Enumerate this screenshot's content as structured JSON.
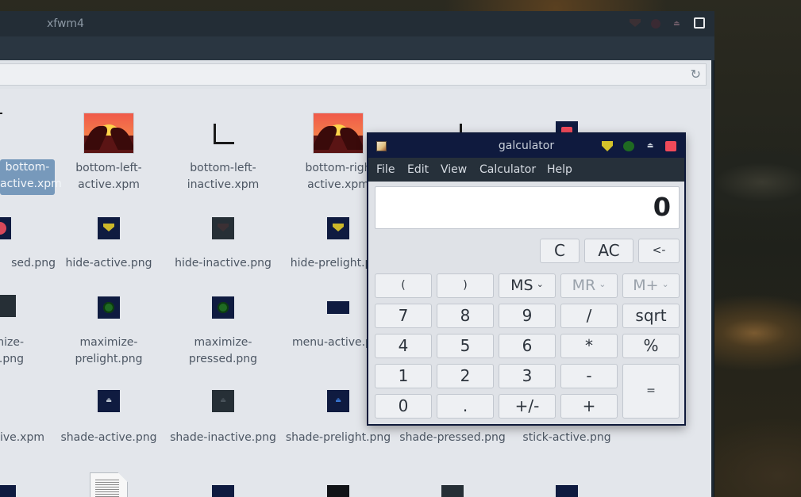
{
  "file_manager": {
    "title": "xfwm4",
    "items": [
      {
        "label": "bottom-\nactive.xpm",
        "thumb": "corner-right-partial",
        "selected": true
      },
      {
        "label": "bottom-left-\nactive.xpm",
        "thumb": "sunset"
      },
      {
        "label": "bottom-left-\ninactive.xpm",
        "thumb": "corner-left"
      },
      {
        "label": "bottom-righ\nactive.xpm",
        "thumb": "sunset"
      },
      {
        "label": "",
        "thumb": "corner-right"
      },
      {
        "label": "",
        "thumb": "close-red"
      },
      {
        "label": "sed.png",
        "thumb": "partial"
      },
      {
        "label": "hide-active.png",
        "thumb": "hide-active"
      },
      {
        "label": "hide-inactive.png",
        "thumb": "hide-inactive"
      },
      {
        "label": "hide-prelight.png",
        "thumb": "hide-prelight"
      },
      {
        "label": "mize-\ne.png",
        "thumb": "partial-dark"
      },
      {
        "label": "maximize-\nprelight.png",
        "thumb": "maximize"
      },
      {
        "label": "maximize-\npressed.png",
        "thumb": "maximize"
      },
      {
        "label": "menu-active.p",
        "thumb": "menu"
      },
      {
        "label": "tive.xpm",
        "thumb": "none"
      },
      {
        "label": "shade-active.png",
        "thumb": "shade-active"
      },
      {
        "label": "shade-inactive.png",
        "thumb": "shade-inactive"
      },
      {
        "label": "shade-prelight.png",
        "thumb": "shade-prelight"
      },
      {
        "label": "shade-pressed.png",
        "thumb": "none"
      },
      {
        "label": "stick-active.png",
        "thumb": "none"
      }
    ]
  },
  "calculator": {
    "title": "galculator",
    "menu": [
      "File",
      "Edit",
      "View",
      "Calculator",
      "Help"
    ],
    "display": "0",
    "buttons": {
      "c": "C",
      "ac": "AC",
      "back": "<-",
      "lparen": "(",
      "rparen": ")",
      "ms": "MS",
      "mr": "MR",
      "mplus": "M+",
      "n7": "7",
      "n8": "8",
      "n9": "9",
      "div": "/",
      "sqrt": "sqrt",
      "n4": "4",
      "n5": "5",
      "n6": "6",
      "mul": "*",
      "pct": "%",
      "n1": "1",
      "n2": "2",
      "n3": "3",
      "sub": "-",
      "eq": "=",
      "n0": "0",
      "dot": ".",
      "neg": "+/-",
      "add": "+"
    },
    "caret": "⌄"
  },
  "icons": {
    "reload": "↻",
    "shade": "⏏"
  },
  "colors": {
    "accent_red": "#f04a5a",
    "accent_yellow": "#d4c22a",
    "accent_green": "#1f6a22",
    "titlebar_navy": "#0f1a3e",
    "selection": "#7799bb"
  }
}
